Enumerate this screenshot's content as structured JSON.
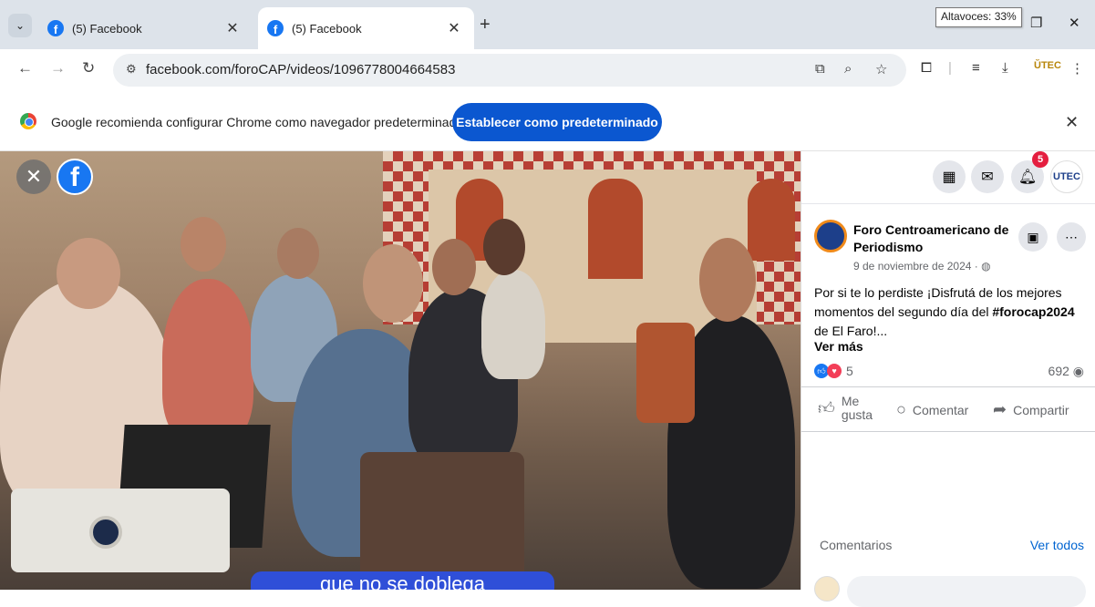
{
  "tabs": [
    {
      "title": "(5) Facebook",
      "active": false
    },
    {
      "title": "(5) Facebook",
      "active": true
    }
  ],
  "window": {
    "tooltip": "Altavoces: 33%",
    "minimize_icon": "minimize-icon",
    "restore_icon": "restore-icon",
    "close_icon": "close-icon"
  },
  "toolbar": {
    "url": "facebook.com/foroCAP/videos/1096778004664583"
  },
  "infobar": {
    "message": "Google recomienda configurar Chrome como navegador predeterminado",
    "button": "Establecer como predeterminado"
  },
  "video": {
    "subtitle": "que no se doblega"
  },
  "facebook": {
    "notifications": "5",
    "post": {
      "page_name": "Foro Centroamericano de Periodismo",
      "date": "9 de noviembre de 2024 · ",
      "text_part1": "Por si te lo perdiste ¡Disfrutá de los mejores momentos del segundo día del ",
      "hashtag": "#forocap2024",
      "text_part2": " de El Faro!...",
      "see_more": "Ver más",
      "reactions_count": "5",
      "views": "692"
    },
    "actions": {
      "like": "Me gusta",
      "comment": "Comentar",
      "share": "Compartir"
    },
    "comments": {
      "label": "Comentarios",
      "see_all": "Ver todos"
    }
  },
  "colors": {
    "facebook_blue": "#1877f2",
    "chrome_blue": "#0b57d0",
    "badge_red": "#e41e3f"
  }
}
